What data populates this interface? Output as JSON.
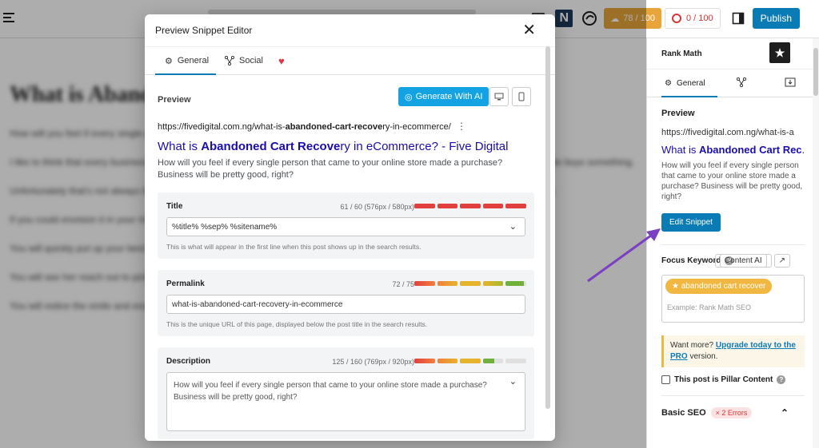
{
  "topbar": {
    "score_seo": "78 / 100",
    "score_readability": "0 / 100",
    "publish_label": "Publish",
    "brand_letter": "N"
  },
  "editor": {
    "heading": "What is Abandoned Cart Recovery in eCommerce?",
    "paragraphs": [
      "How will you feel if every single person that came to your online store made a purchase? Business will be pretty good, right?",
      "I like to think that every business owner dreams about a shop where every person that walks through that door or onto the website buys something.",
      "Unfortunately that's not always the case. Many people will come into your store, take a look around, and move on to other things.",
      "If you could envision it in your mind, it's like a customer walking into your store and the doorbell ring to announce their arrival.",
      "You will quickly put up your best smile and welcome them.",
      "You will see her reach out to pick up a product, look at it closely, and hold it for some time, then looks at the price tag.",
      "You will notice the smile and excitement on her face."
    ]
  },
  "modal": {
    "title": "Preview Snippet Editor",
    "tabs": [
      {
        "label": "General",
        "icon": "gear-icon"
      },
      {
        "label": "Social",
        "icon": "share-icon"
      }
    ],
    "heart_icon": "heart-icon",
    "preview_label": "Preview",
    "generate_ai_label": "Generate With AI",
    "google": {
      "url_prefix": "https://fivedigital.com.ng/what-is-",
      "url_bold": "abandoned-cart-recove",
      "url_suffix": "ry-in-ecommerce/",
      "title_prefix": "What is ",
      "title_bold": "Abandoned Cart Recove",
      "title_suffix": "ry in eCommerce? - Five Digital",
      "description": "How will you feel if every single person that came to your online store made a purchase? Business will be pretty good, right?"
    },
    "fields": {
      "title": {
        "label": "Title",
        "counter": "61 / 60 (576px / 580px)",
        "value": "%title% %sep% %sitename%",
        "help": "This is what will appear in the first line when this post shows up in the search results."
      },
      "permalink": {
        "label": "Permalink",
        "counter": "72 / 75",
        "value": "what-is-abandoned-cart-recovery-in-ecommerce",
        "help": "This is the unique URL of this page, displayed below the post title in the search results."
      },
      "description": {
        "label": "Description",
        "counter": "125 / 160 (769px / 920px)",
        "value": "How will you feel if every single person that came to your online store made a purchase? Business will be pretty good, right?"
      }
    },
    "colors": {
      "accent": "#0b7bb5",
      "ai": "#13a3e3",
      "bar_red": "#e2403e",
      "bar_orange": "#f0803c",
      "bar_yellow": "#e8b32c",
      "bar_green": "#6fb13b"
    }
  },
  "sidebar": {
    "title": "Rank Math",
    "tab_general": "General",
    "preview_label": "Preview",
    "url": "https://fivedigital.com.ng/what-is-a",
    "url_bold": "",
    "link_text_prefix": "What is ",
    "link_text_bold": "Abandoned Cart Rec",
    "link_text_suffix": "...",
    "description": "How will you feel if every single person that came to your online store made a purchase? Business will be pretty good, right?",
    "edit_snippet_label": "Edit Snippet",
    "focus_keyword_label": "Focus Keyword",
    "content_ai_label": "Content AI",
    "keyword_tag": "abandoned cart recover",
    "keyword_placeholder": "Example: Rank Math SEO",
    "want_more": "Want more? ",
    "upgrade_link": "Upgrade today to the PRO",
    "version": " version.",
    "pillar_label": "This post is Pillar Content",
    "basic_seo_label": "Basic SEO",
    "errors_badge": "× 2 Errors"
  }
}
